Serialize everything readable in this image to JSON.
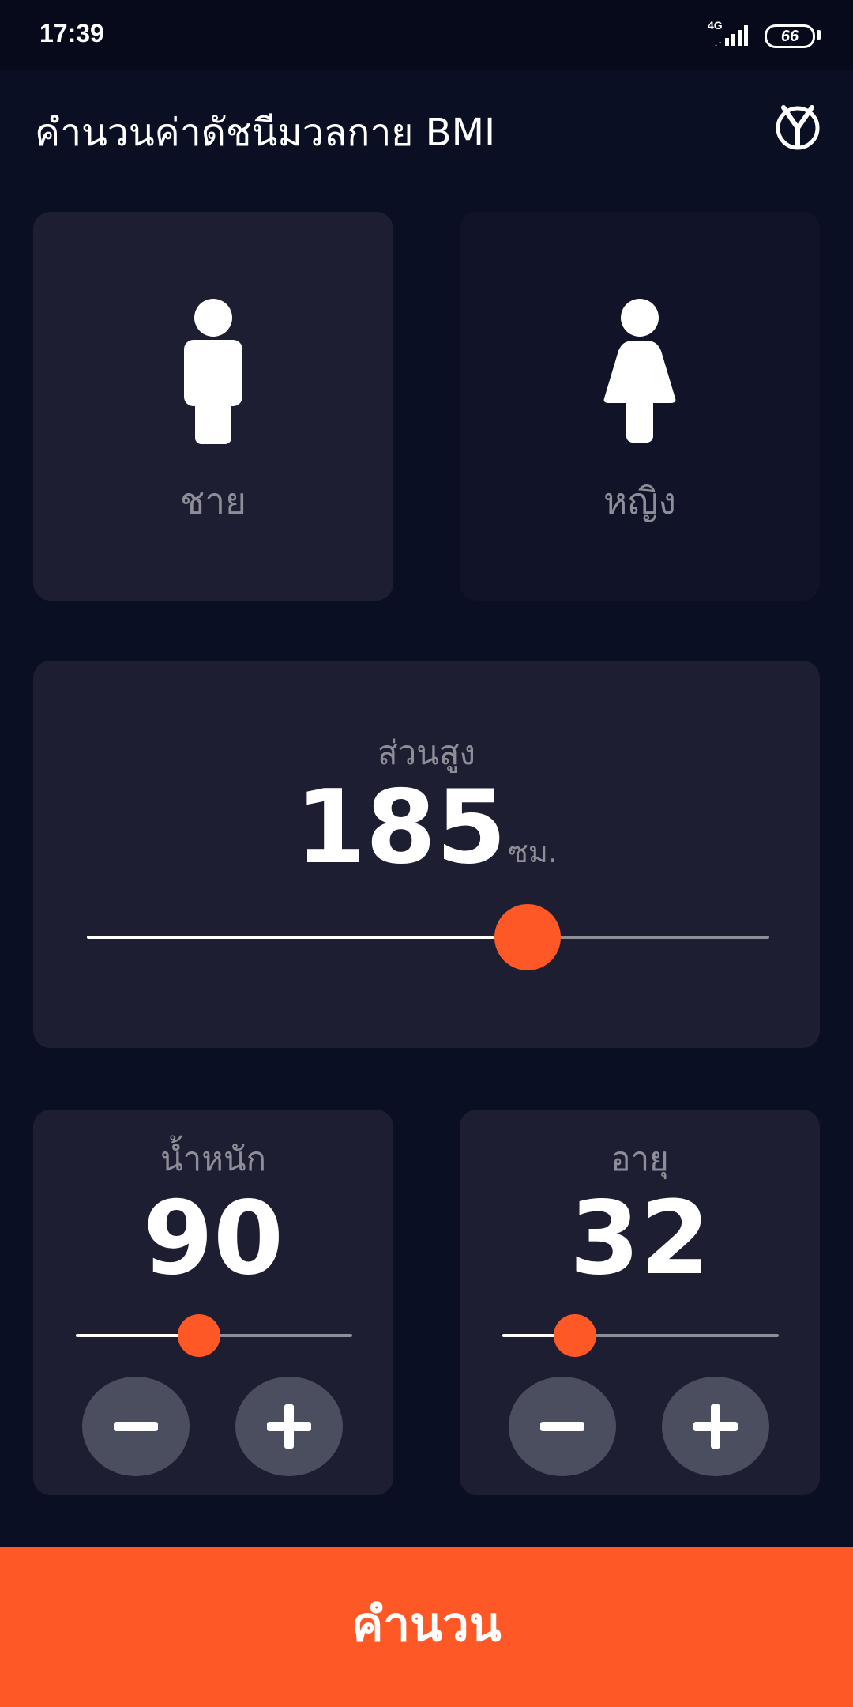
{
  "status_bar": {
    "time": "17:39",
    "network": "4G",
    "battery": "66"
  },
  "header": {
    "title": "คำนวนค่าดัชนีมวลกาย BMI",
    "logo_icon": "y-circle-logo-icon"
  },
  "gender": {
    "male_label": "ชาย",
    "female_label": "หญิง",
    "selected": "male"
  },
  "height": {
    "label": "ส่วนสูง",
    "value": "185",
    "unit": "ซม.",
    "slider_fraction": 0.646
  },
  "weight": {
    "label": "น้ำหนัก",
    "value": "90",
    "slider_fraction": 0.446
  },
  "age": {
    "label": "อายุ",
    "value": "32",
    "slider_fraction": 0.264
  },
  "calculate_label": "คำนวน",
  "colors": {
    "background": "#0b0f23",
    "card_active": "#1e1e33",
    "card_inactive": "#111428",
    "accent": "#fd5825",
    "button_grey": "#4b4e5e"
  }
}
